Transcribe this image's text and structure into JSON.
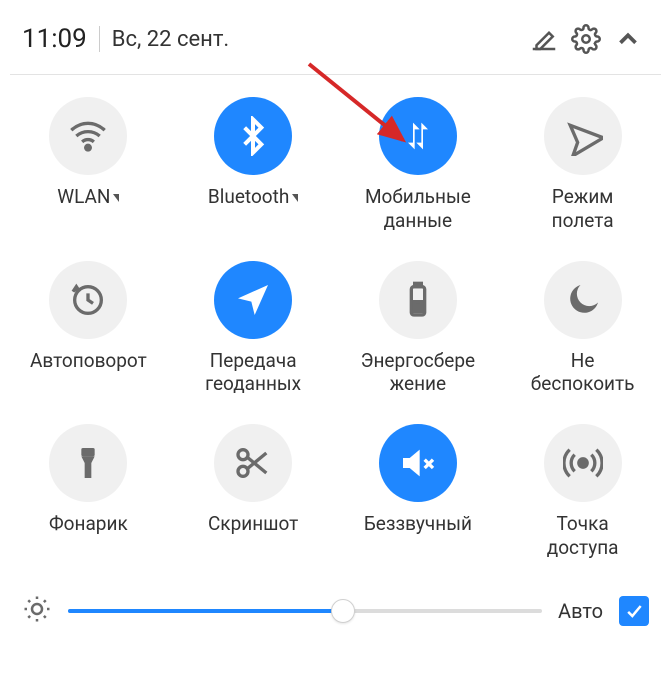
{
  "header": {
    "time": "11:09",
    "date": "Вс, 22 сент."
  },
  "tiles": [
    {
      "id": "wlan",
      "label": "WLAN",
      "on": false,
      "expandable": true
    },
    {
      "id": "bluetooth",
      "label": "Bluetooth",
      "on": true,
      "expandable": true
    },
    {
      "id": "mobiledata",
      "label": "Мобильные\nданные",
      "on": true,
      "expandable": false
    },
    {
      "id": "airplane",
      "label": "Режим\nполета",
      "on": false,
      "expandable": false
    },
    {
      "id": "autorotate",
      "label": "Автоповорот",
      "on": false,
      "expandable": false
    },
    {
      "id": "location",
      "label": "Передача\nгеоданных",
      "on": true,
      "expandable": false
    },
    {
      "id": "battery",
      "label": "Энергосбере\nжение",
      "on": false,
      "expandable": false
    },
    {
      "id": "dnd",
      "label": "Не\nбеспокоить",
      "on": false,
      "expandable": false
    },
    {
      "id": "flashlight",
      "label": "Фонарик",
      "on": false,
      "expandable": false
    },
    {
      "id": "screenshot",
      "label": "Скриншот",
      "on": false,
      "expandable": false
    },
    {
      "id": "mute",
      "label": "Беззвучный",
      "on": true,
      "expandable": false
    },
    {
      "id": "hotspot",
      "label": "Точка\nдоступа",
      "on": false,
      "expandable": false
    }
  ],
  "brightness": {
    "percent": 58,
    "auto_label": "Авто",
    "auto_checked": true
  },
  "colors": {
    "accent": "#1f87ff",
    "tile_off_bg": "#f0f0f0",
    "tile_off_fg": "#6b6b6b",
    "arrow": "#d62828"
  }
}
